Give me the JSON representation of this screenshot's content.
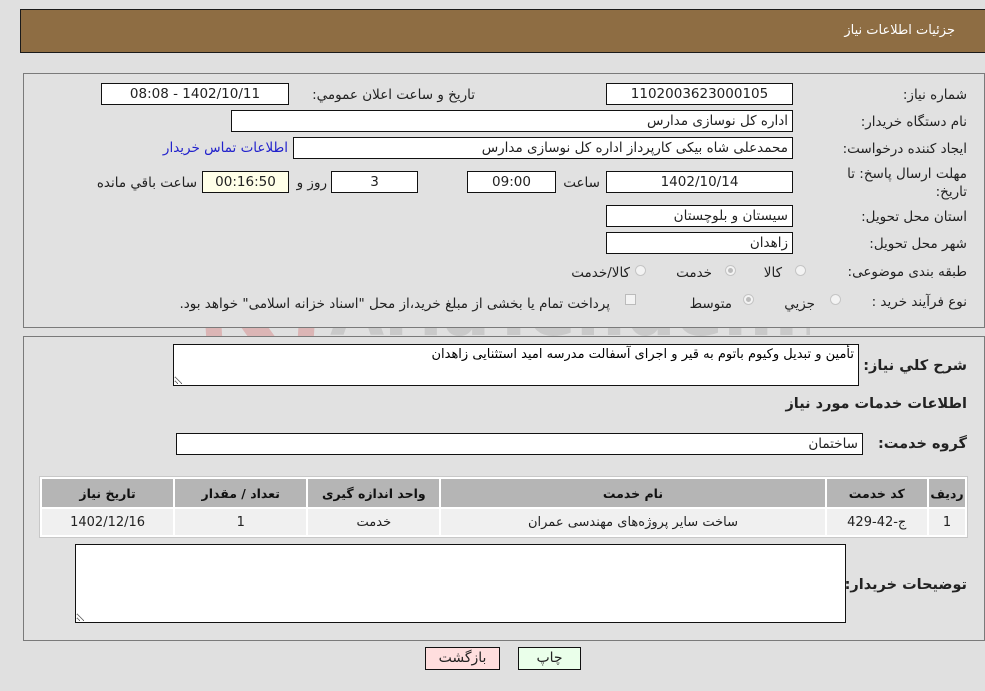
{
  "header": {
    "title": "جزئیات اطلاعات نیاز"
  },
  "need_info": {
    "need_number_label": "شماره نیاز:",
    "need_number": "1102003623000105",
    "announce_label": "تاریخ و ساعت اعلان عمومي:",
    "announce_value": "1402/10/11 - 08:08",
    "buyer_org_label": "نام دستگاه خریدار:",
    "buyer_org": "اداره کل نوسازی مدارس",
    "requester_label": "ایجاد کننده درخواست:",
    "requester": "محمدعلی شاه بیکی کارپرداز اداره کل نوسازی مدارس",
    "buyer_contact_link": "اطلاعات تماس خریدار",
    "deadline_label": "مهلت ارسال پاسخ: تا تاریخ:",
    "deadline_date": "1402/10/14",
    "time_label": "ساعت",
    "deadline_time": "09:00",
    "days_value": "3",
    "days_label": "روز و",
    "remaining_time": "00:16:50",
    "remaining_label": "ساعت باقي مانده",
    "province_label": "استان محل تحویل:",
    "province": "سیستان و بلوچستان",
    "city_label": "شهر محل تحویل:",
    "city": "زاهدان",
    "category_label": "طبقه بندی موضوعی:",
    "category_options": [
      {
        "label": "کالا",
        "checked": false
      },
      {
        "label": "خدمت",
        "checked": true
      },
      {
        "label": "کالا/خدمت",
        "checked": false
      }
    ],
    "process_label": "نوع فرآیند خرید :",
    "process_options": [
      {
        "label": "جزيي",
        "checked": false
      },
      {
        "label": "متوسط",
        "checked": true
      }
    ],
    "treasury_checkbox_label": "پرداخت تمام یا بخشی از مبلغ خرید،از محل \"اسناد خزانه اسلامی\" خواهد بود."
  },
  "description": {
    "label": "شرح كلي نیاز:",
    "value": "تأمین و تبدیل وکیوم باتوم به قیر و اجرای آسفالت مدرسه امید استثنایی زاهدان"
  },
  "services": {
    "section_title": "اطلاعات خدمات مورد نیاز",
    "group_label": "گروه خدمت:",
    "group_value": "ساختمان",
    "columns": [
      "ردیف",
      "کد خدمت",
      "نام خدمت",
      "واحد اندازه گیری",
      "تعداد / مقدار",
      "تاریخ نیاز"
    ],
    "rows": [
      {
        "row": "1",
        "code": "ج-42-429",
        "name": "ساخت سایر پروژه‌های مهندسی عمران",
        "unit": "خدمت",
        "qty": "1",
        "date": "1402/12/16"
      }
    ]
  },
  "buyer_notes": {
    "label": "توضیحات خریدار:",
    "value": ""
  },
  "buttons": {
    "print": "چاپ",
    "back": "بازگشت"
  },
  "watermark": {
    "text": "AriaTender.neT"
  },
  "colors": {
    "header_bg": "#8e6d43",
    "print_bg": "#eaffea",
    "back_bg": "#ffdede",
    "link": "#2222cc"
  }
}
